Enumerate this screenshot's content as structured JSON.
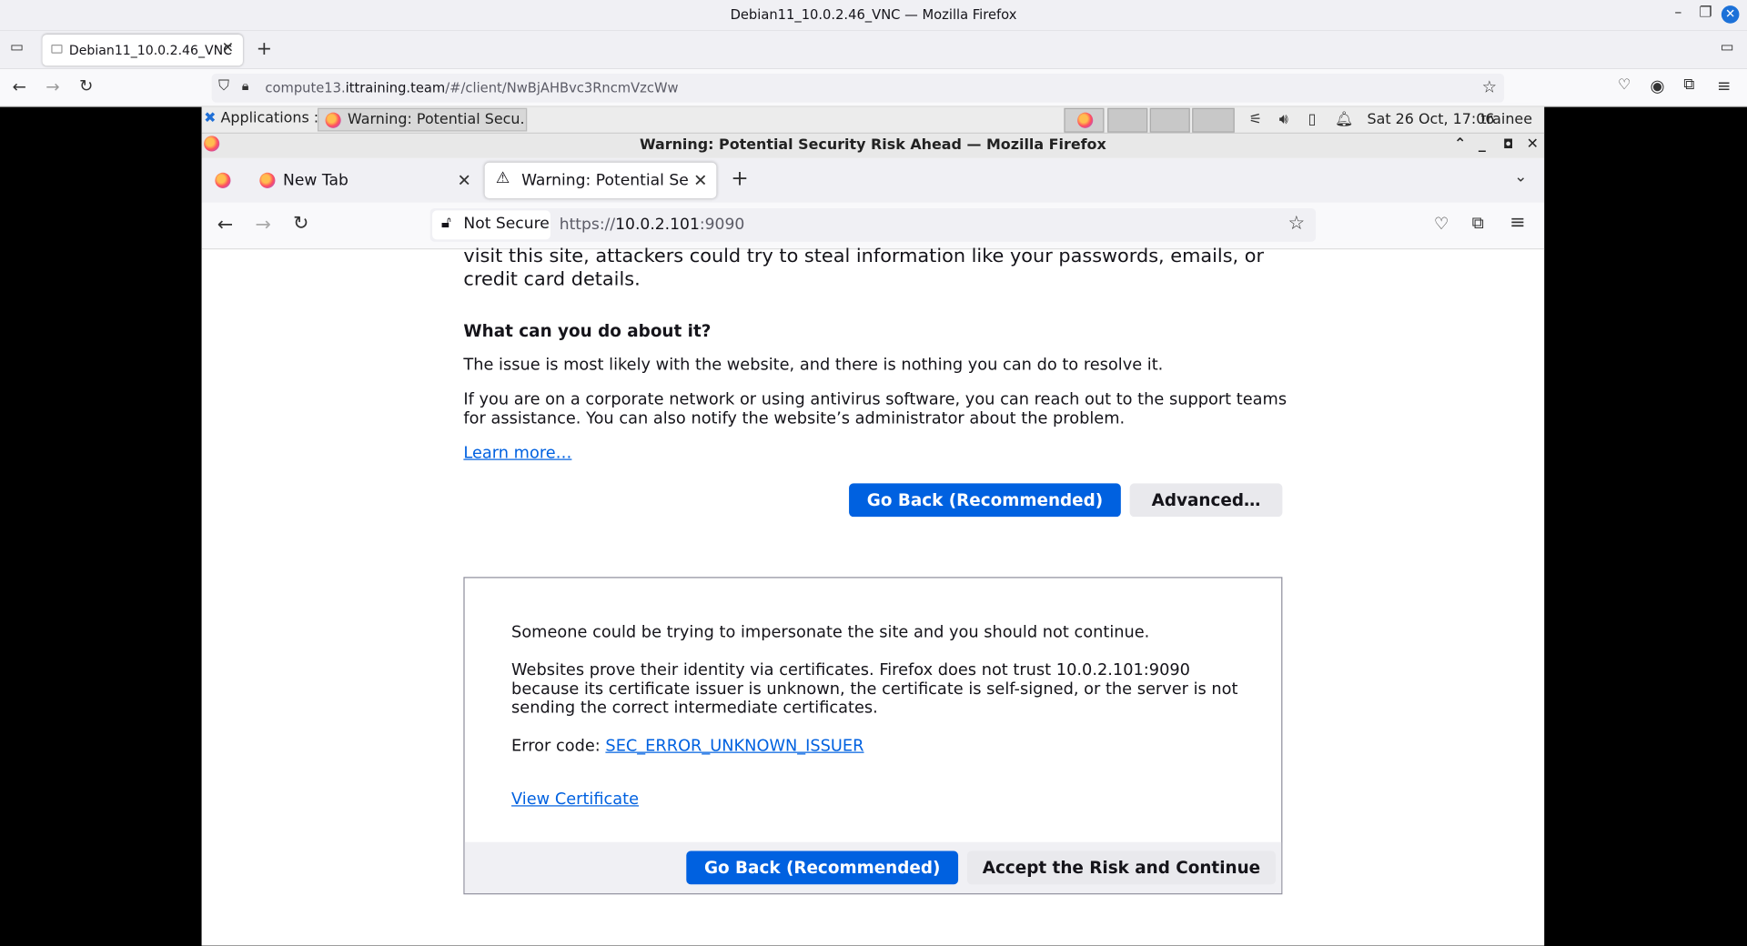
{
  "host": {
    "window_title": "Debian11_10.0.2.46_VNC — Mozilla Firefox",
    "tab_label": "Debian11_10.0.2.46_VNC",
    "url_prefix": "compute13.",
    "url_domain": "ittraining.team",
    "url_rest": "/#/client/NwBjAHBvc3RncmVzcWw"
  },
  "remote_panel": {
    "applications": "Applications :",
    "task_label": "Warning: Potential Secu...",
    "clock": "Sat 26 Oct, 17:06",
    "user": "trainee"
  },
  "inner_browser": {
    "window_title": "Warning: Potential Security Risk Ahead — Mozilla Firefox",
    "tabs": [
      {
        "label": "New Tab"
      },
      {
        "label": "Warning: Potential Securi"
      }
    ],
    "not_secure": "Not Secure",
    "url_scheme": "https://",
    "url_host": "10.0.2.101",
    "url_port": ":9090"
  },
  "page": {
    "intro_line1": "visit this site, attackers could try to steal information like your passwords, emails, or",
    "intro_line2": "credit card details.",
    "heading": "What can you do about it?",
    "para1": "The issue is most likely with the website, and there is nothing you can do to resolve it.",
    "para2_line1": "If you are on a corporate network or using antivirus software, you can reach out to the support teams",
    "para2_line2": "for assistance. You can also notify the website’s administrator about the problem.",
    "learn_more": "Learn more…",
    "go_back": "Go Back (Recommended)",
    "advanced": "Advanced…",
    "adv_line1": "Someone could be trying to impersonate the site and you should not continue.",
    "adv_line2a": "Websites prove their identity via certificates. Firefox does not trust 10.0.2.101:9090",
    "adv_line2b": "because its certificate issuer is unknown, the certificate is self-signed, or the server is not",
    "adv_line2c": "sending the correct intermediate certificates.",
    "error_code_label": "Error code: ",
    "error_code": "SEC_ERROR_UNKNOWN_ISSUER",
    "view_certificate": "View Certificate",
    "accept_risk": "Accept the Risk and Continue"
  }
}
